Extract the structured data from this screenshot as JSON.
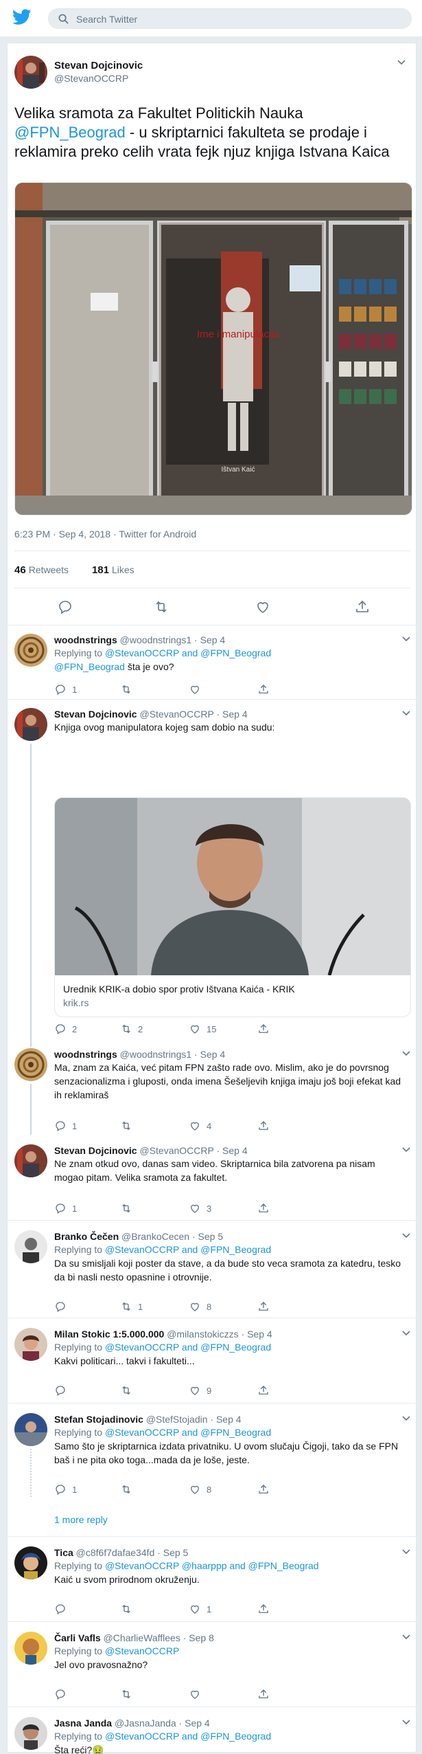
{
  "search": {
    "placeholder": "Search Twitter"
  },
  "tweet": {
    "name": "Stevan Dojcinovic",
    "handle": "@StevanOCCRP",
    "text_1": "Velika sramota za Fakultet Politickih Nauka",
    "text_mention": "@FPN_Beograd",
    "text_2": "- u skriptarnici fakulteta se prodaje i reklamira preko celih vrata fejk njuz knjiga Istvana Kaica",
    "meta": "6:23 PM · Sep 4, 2018 · Twitter for Android",
    "retweets": "46",
    "retweets_label": "Retweets",
    "likes": "181",
    "likes_label": "Likes",
    "poster_title": "Ime i manipulacija",
    "poster_author": "Ištvan Kaić"
  },
  "replies": [
    {
      "name": "woodnstrings",
      "handle": "@woodnstrings1 · Sep 4",
      "replying": "Replying to",
      "to": "@StevanOCCRP and @FPN_Beograd",
      "mention": "@FPN_Beograd",
      "text": " šta je ovo?",
      "replies": "1",
      "retweets": "",
      "likes": ""
    },
    {
      "name": "Stevan Dojcinovic",
      "handle": "@StevanOCCRP · Sep 4",
      "text": "Knjiga ovog manipulatora kojeg sam dobio na sudu:",
      "card_title": "Urednik KRIK-a dobio spor protiv Ištvana Kaića - KRIK",
      "card_domain": "krik.rs",
      "replies": "2",
      "retweets": "2",
      "likes": "15"
    },
    {
      "name": "woodnstrings",
      "handle": "@woodnstrings1 · Sep 4",
      "text": "Ma, znam za Kaića, već pitam FPN zašto rade ovo. Mislim, ako je do povrsnog senzacionalizma i gluposti, onda imena Šešeljevih knjiga imaju još boji efekat kad ih reklamiraš",
      "replies": "1",
      "retweets": "",
      "likes": "4"
    },
    {
      "name": "Stevan Dojcinovic",
      "handle": "@StevanOCCRP · Sep 4",
      "text": "Ne znam otkud ovo, danas sam video. Skriptarnica bila zatvorena pa nisam mogao pitam. Velika sramota za fakultet.",
      "replies": "1",
      "retweets": "",
      "likes": "3"
    },
    {
      "name": "Branko Čečen",
      "handle": "@BrankoCecen · Sep 5",
      "replying": "Replying to",
      "to": "@StevanOCCRP and @FPN_Beograd",
      "text": "Da su smisljali koji poster da stave, a da bude sto veca sramota za katedru, tesko da bi nasli nesto opasnine i otrovnije.",
      "replies": "",
      "retweets": "1",
      "likes": "8"
    },
    {
      "name": "Milan Stokic 1:5.000.000",
      "handle": "@milanstokiczzs · Sep 4",
      "replying": "Replying to",
      "to": "@StevanOCCRP and @FPN_Beograd",
      "text": "Kakvi politicari... takvi i fakulteti...",
      "replies": "",
      "retweets": "",
      "likes": "9"
    },
    {
      "name": "Stefan Stojadinovic",
      "handle": "@StefStojadin · Sep 4",
      "replying": "Replying to",
      "to": "@StevanOCCRP and @FPN_Beograd",
      "text": "Samo što je skriptarnica izdata privatniku. U ovom slučaju Čigoji, tako da se FPN baš i ne pita oko toga...mada da je loše, jeste.",
      "replies": "1",
      "retweets": "",
      "likes": "8",
      "more": "1 more reply"
    },
    {
      "name": "Tica",
      "handle": "@c8f6f7dafae34fd · Sep 5",
      "replying": "Replying to",
      "to": "@StevanOCCRP @haarppp and @FPN_Beograd",
      "text": "Kaić u svom prirodnom okruženju.",
      "replies": "",
      "retweets": "",
      "likes": "1"
    },
    {
      "name": "Čarli Vafls",
      "handle": "@CharlieWafflees · Sep 8",
      "replying": "Replying to",
      "to": "@StevanOCCRP",
      "text": "Jel ovo pravosnažno?",
      "replies": "",
      "retweets": "",
      "likes": ""
    },
    {
      "name": "Jasna Janda",
      "handle": "@JasnaJanda · Sep 4",
      "replying": "Replying to",
      "to": "@StevanOCCRP and @FPN_Beograd",
      "text": "Šta reći?🤢",
      "replies": "",
      "retweets": "",
      "likes": ""
    }
  ],
  "colors": {
    "accent": "#1b95e0",
    "bg": "#e6ecf0",
    "muted": "#657786"
  }
}
